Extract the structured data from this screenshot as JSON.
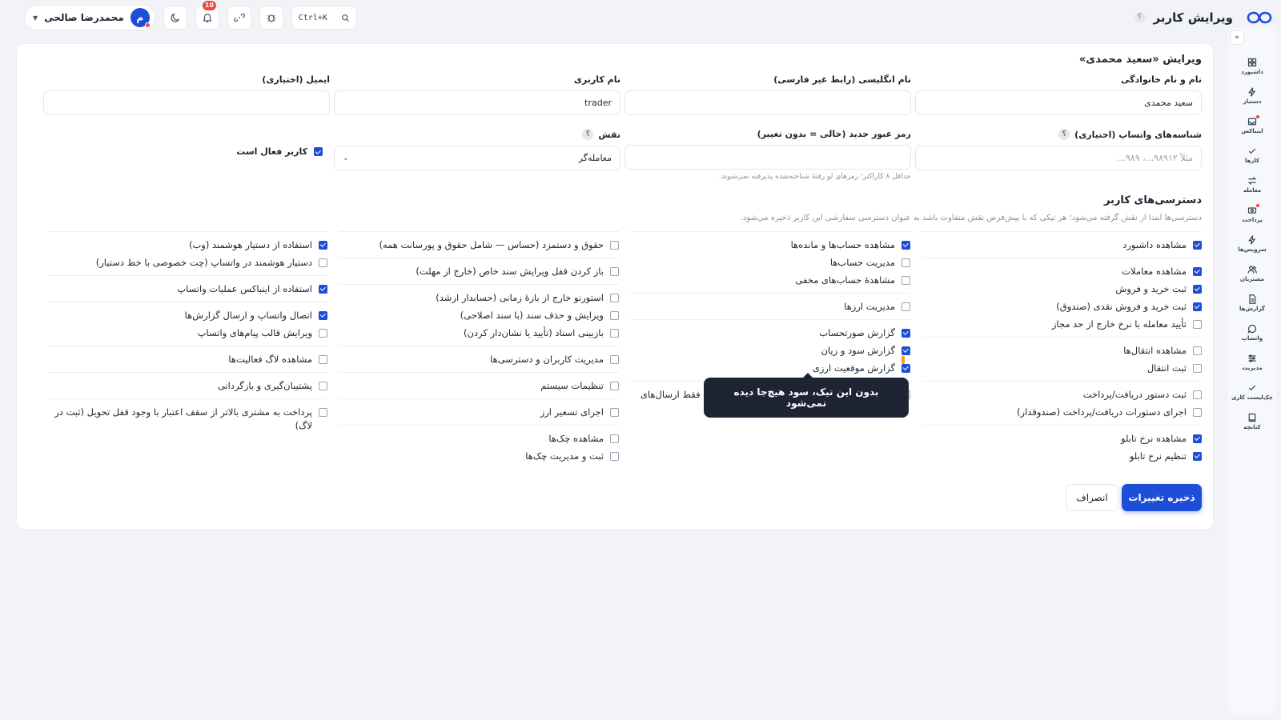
{
  "header": {
    "title": "ویرایش کاربر",
    "help": "؟",
    "search_shortcut": "Ctrl+K",
    "notifications_count": "10",
    "user_name": "محمدرضا صالحی",
    "user_initial": "م"
  },
  "sidebar": {
    "collapse": "«",
    "items": [
      {
        "label": "داشبورد",
        "icon": "grid-icon"
      },
      {
        "label": "دستیار",
        "icon": "bolt-icon"
      },
      {
        "label": "اینباکس",
        "icon": "inbox-icon"
      },
      {
        "label": "کارها",
        "icon": "check-icon"
      },
      {
        "label": "معامله",
        "icon": "swap-icon"
      },
      {
        "label": "پرداخت",
        "icon": "cash-icon"
      },
      {
        "label": "سرویس‌ها",
        "icon": "bolt-icon"
      },
      {
        "label": "مشتریان",
        "icon": "users-icon"
      },
      {
        "label": "گزارش‌ها",
        "icon": "doc-icon"
      },
      {
        "label": "واتساپ",
        "icon": "chat-icon"
      },
      {
        "label": "مدیریت",
        "icon": "sliders-icon"
      },
      {
        "label": "چک‌لیست کاری",
        "icon": "check-icon"
      },
      {
        "label": "کتابچه",
        "icon": "book-icon"
      }
    ]
  },
  "form": {
    "title": "ویرایش «سعید محمدی»",
    "full_name": {
      "label": "نام و نام خانوادگی",
      "value": "سعید محمدی"
    },
    "english_name": {
      "label": "نام انگلیسی (رابط غیر فارسی)",
      "value": ""
    },
    "username": {
      "label": "نام کاربری",
      "value": "trader"
    },
    "email": {
      "label": "ایمیل (اختیاری)",
      "value": ""
    },
    "whatsapp": {
      "label": "شناسه‌های واتساپ (اختیاری)",
      "placeholder": "مثلاً ۹۸۹۱۲...، ۹۸۹..."
    },
    "password": {
      "label": "رمز عبور جدید (خالی = بدون تغییر)",
      "value": "",
      "hint": "حداقل ۸ کاراکتر؛ رمزهای لو رفتهٔ شناخته‌شده پذیرفته نمی‌شوند."
    },
    "role": {
      "label": "نقش",
      "value": "معامله‌گر"
    },
    "active": {
      "label": "کاربر فعال است",
      "checked": true
    }
  },
  "permissions": {
    "title": "دسترسی‌های کاربر",
    "subtitle": "دسترسی‌ها ابتدا از نقش گرفته می‌شود؛ هر تیکی که با پیش‌فرض نقش متفاوت باشد به عنوان دسترسی سفارشی این کاربر ذخیره می‌شود.",
    "columns": [
      [
        [
          {
            "label": "مشاهده داشبورد",
            "checked": true
          }
        ],
        [
          {
            "label": "مشاهده معاملات",
            "checked": true
          },
          {
            "label": "ثبت خرید و فروش",
            "checked": true
          },
          {
            "label": "ثبت خرید و فروش نقدی (صندوق)",
            "checked": true
          },
          {
            "label": "تأیید معامله با نرخ خارج از حد مجاز",
            "checked": false
          }
        ],
        [
          {
            "label": "مشاهده انتقال‌ها",
            "checked": false
          },
          {
            "label": "ثبت انتقال",
            "checked": false
          }
        ],
        [
          {
            "label": "ثبت دستور دریافت/پرداخت",
            "checked": false
          },
          {
            "label": "اجرای دستورات دریافت/پرداخت (صندوقدار)",
            "checked": false
          }
        ],
        [
          {
            "label": "مشاهده نرخ تابلو",
            "checked": true
          },
          {
            "label": "تنظیم نرخ تابلو",
            "checked": true
          }
        ]
      ],
      [
        [
          {
            "label": "مشاهده حساب‌ها و مانده‌ها",
            "checked": true
          },
          {
            "label": "مدیریت حساب‌ها",
            "checked": false
          },
          {
            "label": "مشاهدهٔ حساب‌های مخفی",
            "checked": false
          }
        ],
        [
          {
            "label": "مدیریت ارزها",
            "checked": false
          }
        ],
        [
          {
            "label": "گزارش صورتحساب",
            "checked": true
          },
          {
            "label": "گزارش سود و زیان",
            "checked": true
          },
          {
            "label": "گزارش موقعیت ارزی",
            "checked": true
          }
        ],
        [
          {
            "label": "گزارش ارسال‌های واتساپ همهٔ کاربران (بدون آن: فقط ارسال‌های خودش)",
            "checked": false
          }
        ]
      ],
      [
        [
          {
            "label": "حقوق و دستمزد (حساس — شامل حقوق و پورسانت همه)",
            "checked": false
          }
        ],
        [
          {
            "label": "باز کردن قفل ویرایش سند خاص (خارج از مهلت)",
            "checked": false
          }
        ],
        [
          {
            "label": "استورنو خارج از بازهٔ زمانی (حسابدار ارشد)",
            "checked": false
          },
          {
            "label": "ویرایش و حذف سند (با سند اصلاحی)",
            "checked": false
          },
          {
            "label": "بازبینی اسناد (تأیید یا نشان‌دار کردن)",
            "checked": false
          }
        ],
        [
          {
            "label": "مدیریت کاربران و دسترسی‌ها",
            "checked": false
          }
        ],
        [
          {
            "label": "تنظیمات سیستم",
            "checked": false
          }
        ],
        [
          {
            "label": "اجرای تسعیر ارز",
            "checked": false
          }
        ],
        [
          {
            "label": "مشاهده چک‌ها",
            "checked": false
          },
          {
            "label": "ثبت و مدیریت چک‌ها",
            "checked": false
          }
        ]
      ],
      [
        [
          {
            "label": "استفاده از دستیار هوشمند (وب)",
            "checked": true
          },
          {
            "label": "دستیار هوشمند در واتساپ (چت خصوصی با خط دستیار)",
            "checked": false
          }
        ],
        [
          {
            "label": "استفاده از اینباکس عملیات واتساپ",
            "checked": true
          }
        ],
        [
          {
            "label": "اتصال واتساپ و ارسال گزارش‌ها",
            "checked": true
          },
          {
            "label": "ویرایش قالب پیام‌های واتساپ",
            "checked": false
          }
        ],
        [
          {
            "label": "مشاهده لاگ فعالیت‌ها",
            "checked": false
          }
        ],
        [
          {
            "label": "پشتیبان‌گیری و بازگردانی",
            "checked": false
          }
        ],
        [
          {
            "label": "پرداخت به مشتری بالاتر از سقف اعتبار با وجود قفل تحویل (ثبت در لاگ)",
            "checked": false
          }
        ]
      ]
    ]
  },
  "tooltip": "بدون این تیک، سود هیچ‌جا دیده نمی‌شود",
  "actions": {
    "save": "ذخیره تغییرات",
    "cancel": "انصراف"
  },
  "colors": {
    "accent": "#1d4ed8",
    "tooltip_bg": "#1e2433",
    "background": "#f1f3f7"
  }
}
